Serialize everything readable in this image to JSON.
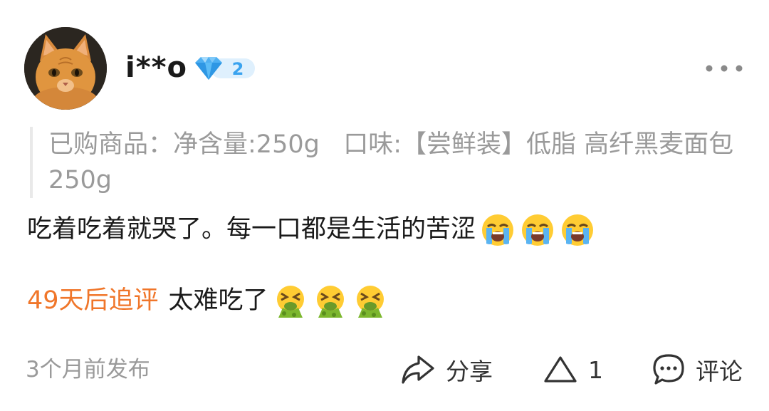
{
  "user": {
    "name": "i**o",
    "level": "2",
    "avatar_icon": "orange-cat-avatar",
    "badge_icon": "diamond-icon"
  },
  "product": {
    "prefix": "已购商品：",
    "spec": "净含量:250g   口味:【尝鲜装】低脂 高纤黑麦面包 250g"
  },
  "review": {
    "text": "吃着吃着就哭了。每一口都是生活的苦涩",
    "emoji": "loudly-crying-face",
    "emoji_count": 3
  },
  "followup": {
    "label": "49天后追评",
    "text": "太难吃了",
    "emoji": "vomiting-face",
    "emoji_count": 3
  },
  "footer": {
    "time": "3个月前发布",
    "share_label": "分享",
    "like_count": "1",
    "comment_label": "评论"
  },
  "colors": {
    "accent_orange": "#f0762a",
    "muted_gray": "#9a9a9a",
    "badge_blue": "#5bb8f5"
  }
}
